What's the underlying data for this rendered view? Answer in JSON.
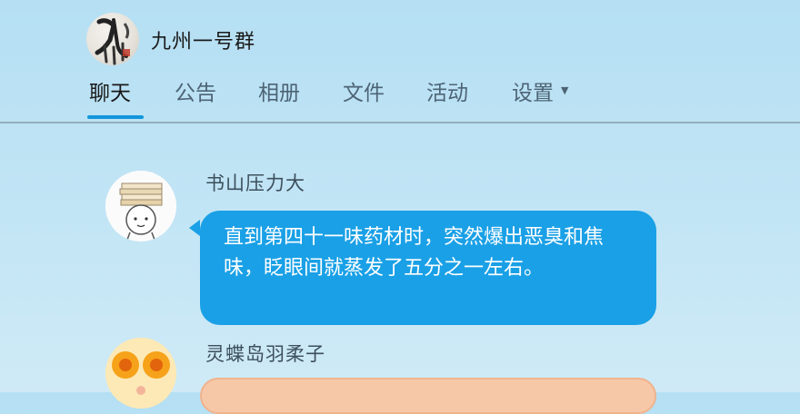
{
  "group": {
    "name": "九州一号群",
    "avatar_text": "九洲"
  },
  "tabs": [
    {
      "label": "聊天",
      "active": true
    },
    {
      "label": "公告",
      "active": false
    },
    {
      "label": "相册",
      "active": false
    },
    {
      "label": "文件",
      "active": false
    },
    {
      "label": "活动",
      "active": false
    },
    {
      "label": "设置",
      "active": false,
      "has_dropdown": true
    }
  ],
  "messages": [
    {
      "sender": "书山压力大",
      "text": "直到第四十一味药材时，突然爆出恶臭和焦味，眨眼间就蒸发了五分之一左右。",
      "avatar_icon": "book-stack-character-icon",
      "bubble_color": "#1aa0e6"
    },
    {
      "sender": "灵蝶岛羽柔子",
      "text": "",
      "avatar_icon": "flower-eyes-character-icon",
      "bubble_color": "#f6c8a8"
    }
  ],
  "colors": {
    "accent": "#1296db",
    "background": "#b5dff3"
  }
}
